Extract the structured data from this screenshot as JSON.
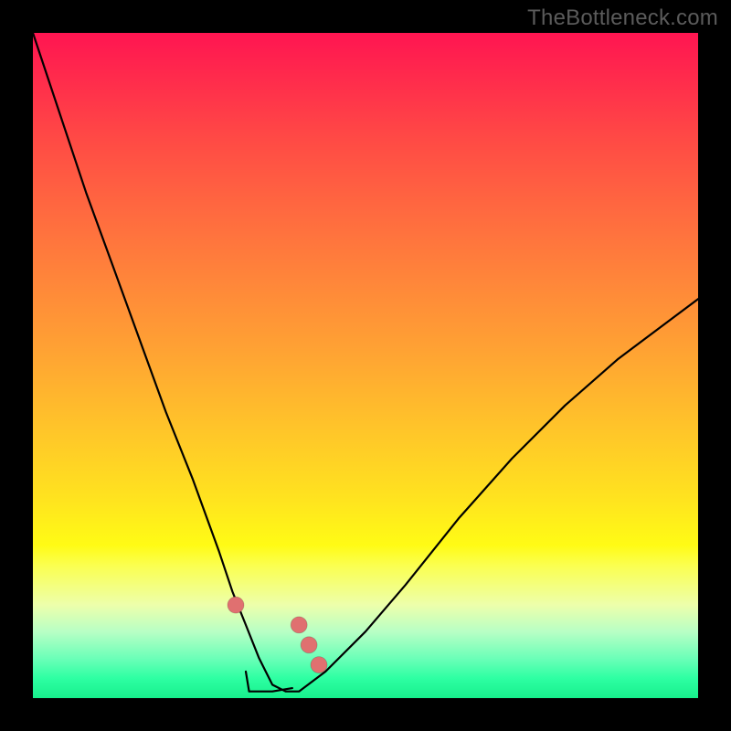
{
  "watermark": "TheBottleneck.com",
  "colors": {
    "frame": "#000000",
    "curve": "#000000",
    "marker": "#e07070",
    "gradient_top": "#ff1551",
    "gradient_bottom": "#17f08c"
  },
  "chart_data": {
    "type": "line",
    "title": "",
    "xlabel": "",
    "ylabel": "",
    "xlim": [
      0,
      100
    ],
    "ylim": [
      0,
      100
    ],
    "series": [
      {
        "name": "bottleneck-curve",
        "x": [
          0,
          4,
          8,
          12,
          16,
          20,
          24,
          28,
          30,
          32,
          34,
          35,
          36,
          38,
          40,
          44,
          50,
          56,
          64,
          72,
          80,
          88,
          96,
          100
        ],
        "y": [
          100,
          88,
          76,
          65,
          54,
          43,
          33,
          22,
          16,
          11,
          6,
          4,
          2,
          1,
          1,
          4,
          10,
          17,
          27,
          36,
          44,
          51,
          57,
          60
        ]
      }
    ],
    "markers": [
      {
        "name": "left-upper-dot",
        "x": 30.5,
        "y": 14
      },
      {
        "name": "right-dot-1",
        "x": 40.0,
        "y": 11
      },
      {
        "name": "right-dot-2",
        "x": 41.5,
        "y": 8
      },
      {
        "name": "right-dot-3",
        "x": 43.0,
        "y": 5
      }
    ],
    "bottom_segment": {
      "points": [
        {
          "x": 32.0,
          "y": 4
        },
        {
          "x": 32.5,
          "y": 1
        },
        {
          "x": 36.0,
          "y": 1
        },
        {
          "x": 39.0,
          "y": 1.5
        }
      ]
    }
  }
}
